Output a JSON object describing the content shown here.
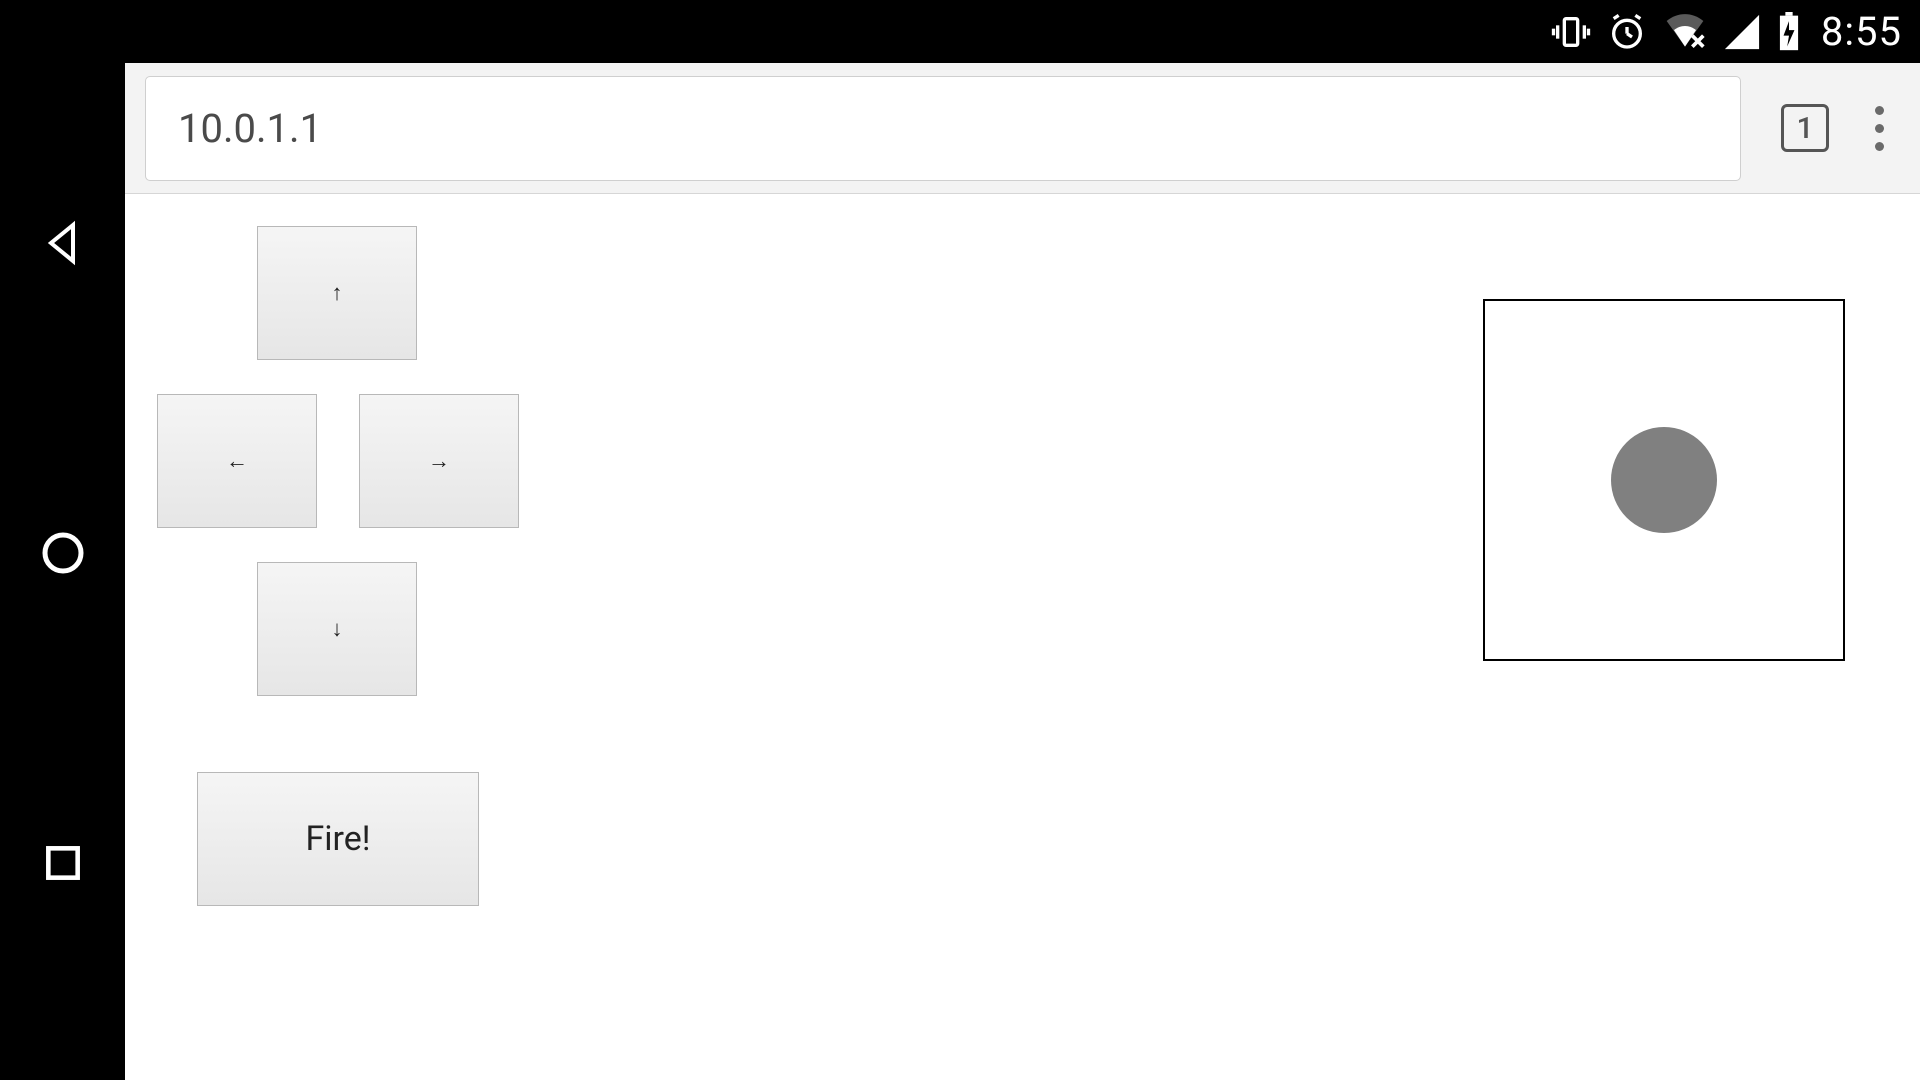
{
  "status": {
    "clock": "8:55",
    "icons": {
      "vibrate": "vibrate-icon",
      "alarm": "alarm-icon",
      "wifi": "wifi-icon",
      "signal": "cell-signal-icon",
      "battery": "battery-charging-icon"
    }
  },
  "nav": {
    "back": "back-icon",
    "home": "home-icon",
    "recent": "recent-apps-icon"
  },
  "browser": {
    "url": "10.0.1.1",
    "tab_count": "1",
    "menu": "menu-icon"
  },
  "controls": {
    "up": "↑",
    "left": "←",
    "right": "→",
    "down": "↓",
    "fire": "Fire!"
  },
  "joystick": {
    "label": "joystick"
  }
}
